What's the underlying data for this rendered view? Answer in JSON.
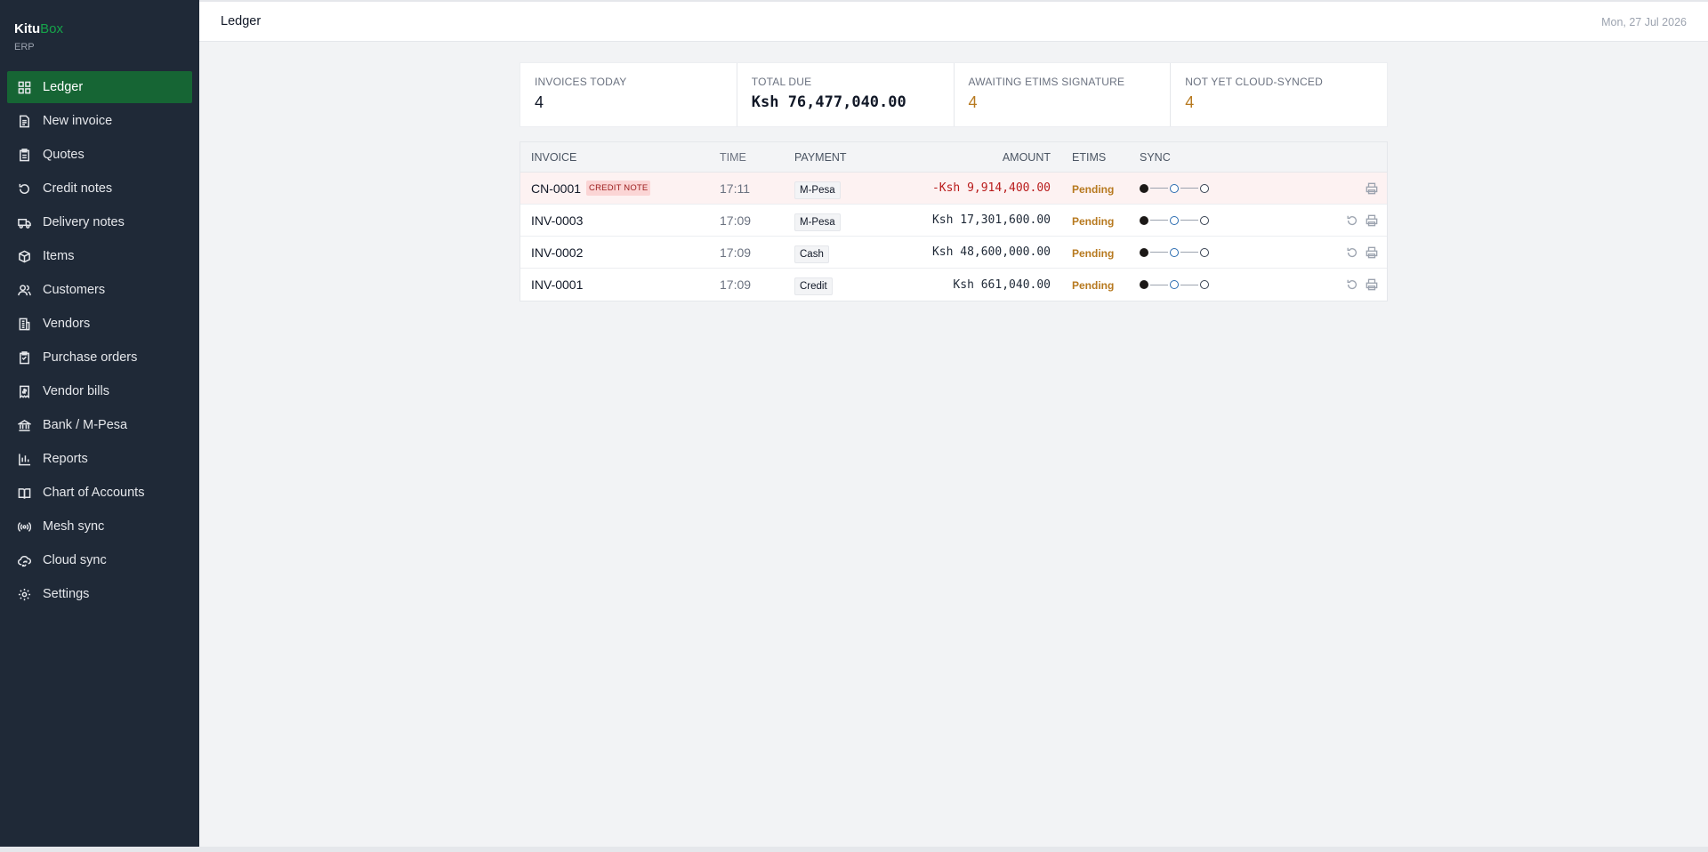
{
  "brand": {
    "name": "Kitu",
    "name_accent": "Box",
    "subtitle": "ERP"
  },
  "sidebar": {
    "items": [
      {
        "label": "Ledger",
        "icon": "grid-icon",
        "active": true
      },
      {
        "label": "New invoice",
        "icon": "document-icon"
      },
      {
        "label": "Quotes",
        "icon": "clipboard-icon"
      },
      {
        "label": "Credit notes",
        "icon": "undo-icon"
      },
      {
        "label": "Delivery notes",
        "icon": "truck-icon"
      },
      {
        "label": "Items",
        "icon": "package-icon"
      },
      {
        "label": "Customers",
        "icon": "users-icon"
      },
      {
        "label": "Vendors",
        "icon": "building-icon"
      },
      {
        "label": "Purchase orders",
        "icon": "clipboard-list-icon"
      },
      {
        "label": "Vendor bills",
        "icon": "receipt-icon"
      },
      {
        "label": "Bank / M-Pesa",
        "icon": "bank-icon"
      },
      {
        "label": "Reports",
        "icon": "bar-chart-icon"
      },
      {
        "label": "Chart of Accounts",
        "icon": "book-icon"
      },
      {
        "label": "Mesh sync",
        "icon": "radio-icon"
      },
      {
        "label": "Cloud sync",
        "icon": "cloud-sync-icon"
      },
      {
        "label": "Settings",
        "icon": "gear-icon"
      }
    ]
  },
  "header": {
    "title": "Ledger",
    "date": "Mon, 27 Jul 2026"
  },
  "stats": [
    {
      "label": "INVOICES TODAY",
      "value": "4"
    },
    {
      "label": "TOTAL DUE",
      "value": "Ksh 76,477,040.00"
    },
    {
      "label": "AWAITING ETIMS SIGNATURE",
      "value": "4"
    },
    {
      "label": "NOT YET CLOUD-SYNCED",
      "value": "4"
    }
  ],
  "table": {
    "columns": {
      "invoice": "INVOICE",
      "time": "TIME",
      "payment": "PAYMENT",
      "amount": "AMOUNT",
      "etims": "ETIMS",
      "sync": "SYNC"
    },
    "rows": [
      {
        "invoice": "CN-0001",
        "badge": "CREDIT NOTE",
        "time": "17:11",
        "payment": "M-Pesa",
        "amount": "-Ksh 9,914,400.00",
        "etims": "Pending"
      },
      {
        "invoice": "INV-0003",
        "badge": "",
        "time": "17:09",
        "payment": "M-Pesa",
        "amount": "Ksh 17,301,600.00",
        "etims": "Pending"
      },
      {
        "invoice": "INV-0002",
        "badge": "",
        "time": "17:09",
        "payment": "Cash",
        "amount": "Ksh 48,600,000.00",
        "etims": "Pending"
      },
      {
        "invoice": "INV-0001",
        "badge": "",
        "time": "17:09",
        "payment": "Credit",
        "amount": "Ksh 661,040.00",
        "etims": "Pending"
      }
    ]
  },
  "colors": {
    "sidebar_bg": "#1f2937",
    "active_nav": "#166534",
    "pending": "#b7791f",
    "negative": "#b91c1c",
    "brand_accent": "#16a34a"
  }
}
